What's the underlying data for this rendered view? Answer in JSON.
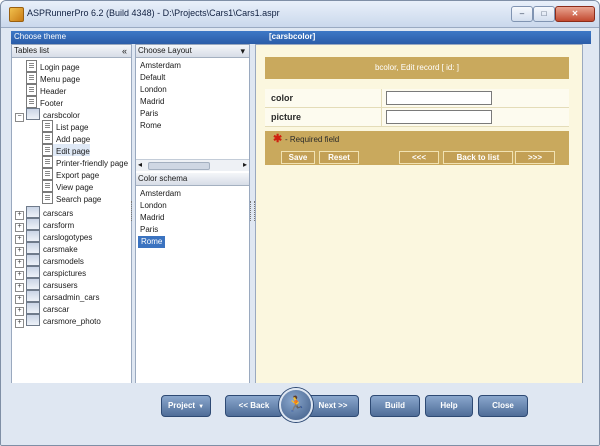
{
  "window": {
    "title": "ASPRunnerPro 6.2 (Build 4348) - D:\\Projects\\Cars1\\Cars1.aspr",
    "min_glyph": "–",
    "max_glyph": "□",
    "close_glyph": "✕"
  },
  "theme_bar": {
    "label": "Choose theme",
    "table_name": "[carsbcolor]"
  },
  "tables_panel": {
    "header": "Tables list",
    "collapse_glyph": "«",
    "pages_top": [
      "Login page",
      "Menu page",
      "Header",
      "Footer"
    ],
    "expanded_table": "carsbcolor",
    "expanded_pages": [
      "List page",
      "Add page",
      "Edit page",
      "Printer-friendly page",
      "Export page",
      "View page",
      "Search page"
    ],
    "selected_page": "Edit page",
    "tables": [
      "carscars",
      "carsform",
      "carslogotypes",
      "carsmake",
      "carsmodels",
      "carspictures",
      "carsusers",
      "carsadmin_cars",
      "carscar",
      "carsmore_photo"
    ]
  },
  "layout_panel": {
    "header": "Choose Layout",
    "layouts": [
      "Amsterdam",
      "Default",
      "London",
      "Madrid",
      "Paris",
      "Rome"
    ],
    "color_schema_header": "Color schema",
    "color_schemas": [
      "Amsterdam",
      "London",
      "Madrid",
      "Paris",
      "Rome"
    ],
    "selected_schema": "Rome",
    "scroll_thumb_glyph": "III"
  },
  "preview": {
    "form_title": "bcolor, Edit record [ id: ]",
    "fields": [
      {
        "label": "color",
        "value": ""
      },
      {
        "label": "picture",
        "value": ""
      }
    ],
    "required_note": "- Required field",
    "buttons": {
      "save": "Save",
      "reset": "Reset",
      "prev": "<<<",
      "back": "Back to list",
      "next": ">>>"
    }
  },
  "nav": {
    "project": "Project",
    "back": "<< Back",
    "next": "Next >>",
    "build": "Build",
    "help": "Help",
    "close": "Close"
  },
  "colors": {
    "accent_blue": "#2b5da8",
    "form_gold": "#c9a95d",
    "selected_blue": "#3b73c0"
  }
}
